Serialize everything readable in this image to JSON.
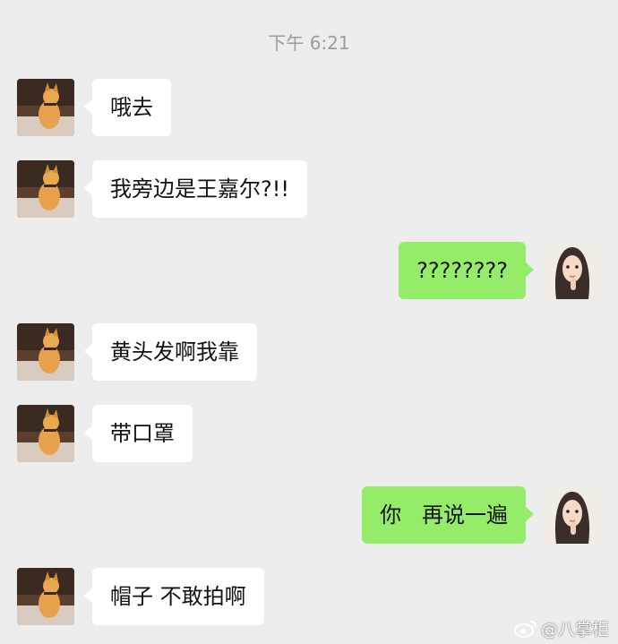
{
  "timestamp": "下午 6:21",
  "messages": [
    {
      "side": "in",
      "text": "哦去"
    },
    {
      "side": "in",
      "text": "我旁边是王嘉尔?!!"
    },
    {
      "side": "out",
      "text": "????????"
    },
    {
      "side": "in",
      "text": "黄头发啊我靠"
    },
    {
      "side": "in",
      "text": "带口罩"
    },
    {
      "side": "out",
      "text": "你   再说一遍"
    },
    {
      "side": "in",
      "text": "帽子 不敢拍啊"
    }
  ],
  "watermark": {
    "text": "@八掌柜",
    "icon": "weibo-icon"
  },
  "colors": {
    "background": "#ededed",
    "incoming": "#ffffff",
    "outgoing": "#95ec69"
  }
}
